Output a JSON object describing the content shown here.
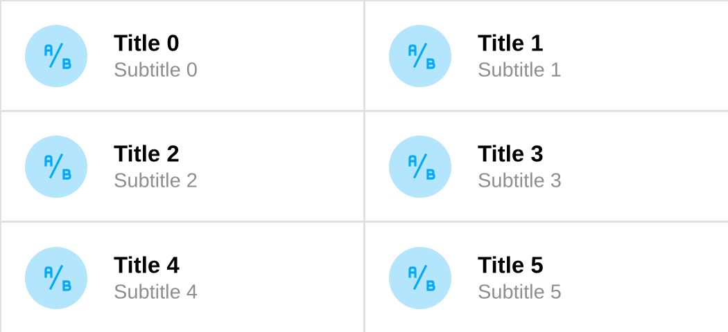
{
  "colors": {
    "avatar_background": "#b3e5fc",
    "avatar_glyph": "#03a9f4",
    "title": "#000000",
    "subtitle": "#8e8e8e",
    "divider": "#e0e0e0"
  },
  "items": [
    {
      "icon": "ab-test-icon",
      "avatar_text": "A/B",
      "title": "Title 0",
      "subtitle": "Subtitle 0"
    },
    {
      "icon": "ab-test-icon",
      "avatar_text": "A/B",
      "title": "Title 1",
      "subtitle": "Subtitle 1"
    },
    {
      "icon": "ab-test-icon",
      "avatar_text": "A/B",
      "title": "Title 2",
      "subtitle": "Subtitle 2"
    },
    {
      "icon": "ab-test-icon",
      "avatar_text": "A/B",
      "title": "Title 3",
      "subtitle": "Subtitle 3"
    },
    {
      "icon": "ab-test-icon",
      "avatar_text": "A/B",
      "title": "Title 4",
      "subtitle": "Subtitle 4"
    },
    {
      "icon": "ab-test-icon",
      "avatar_text": "A/B",
      "title": "Title 5",
      "subtitle": "Subtitle 5"
    }
  ]
}
